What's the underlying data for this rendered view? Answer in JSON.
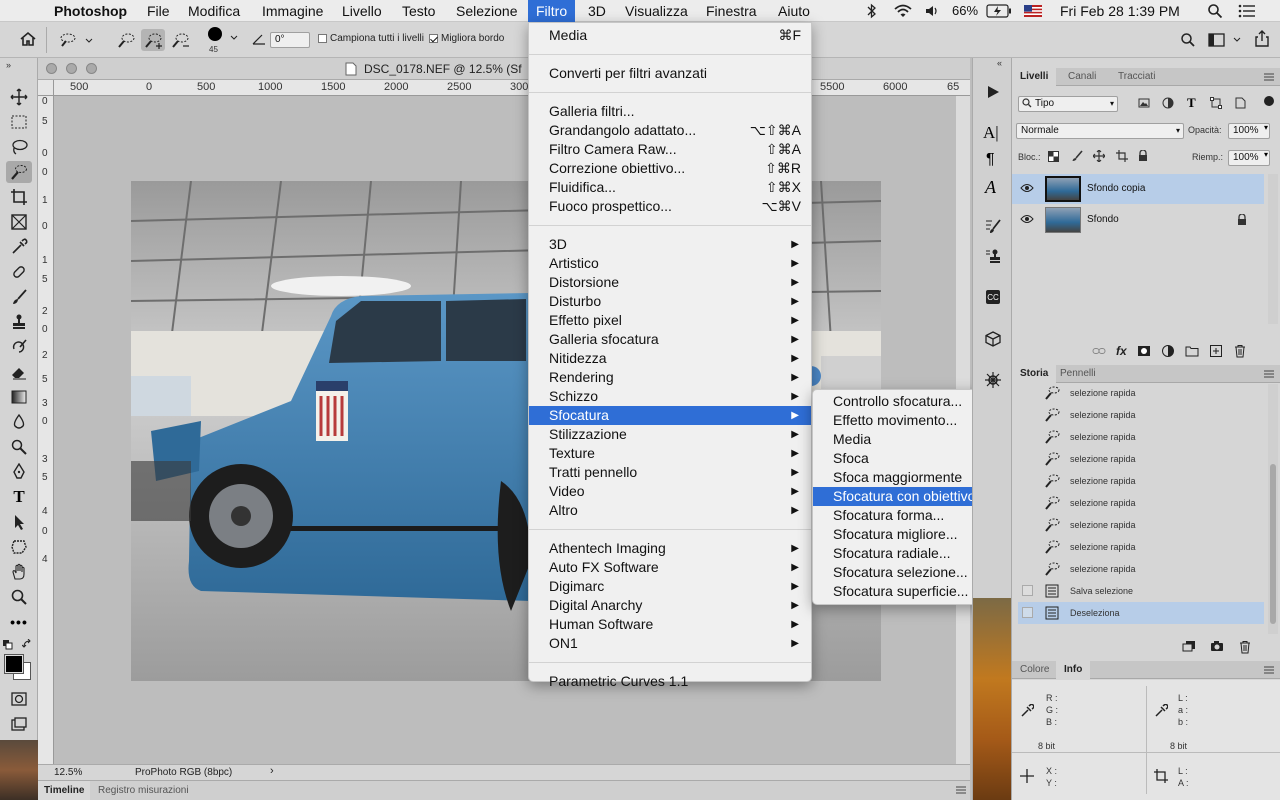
{
  "menubar": {
    "apple": "",
    "app": "Photoshop",
    "items": [
      "File",
      "Modifica",
      "Immagine",
      "Livello",
      "Testo",
      "Selezione",
      "Filtro",
      "3D",
      "Visualizza",
      "Finestra",
      "Aiuto"
    ],
    "battery": "66%",
    "datetime": "Fri Feb 28  1:39 PM"
  },
  "options": {
    "brush_size": "45",
    "angle": "0°",
    "sample_all_layers": "Campiona tutti i livelli",
    "enhance_edge": "Migliora bordo"
  },
  "document": {
    "title": "DSC_0178.NEF @ 12.5% (Sf",
    "ruler_h": [
      "500",
      "0",
      "500",
      "1000",
      "1500",
      "2000",
      "2500",
      "300"
    ],
    "ruler_h_right": [
      "5500",
      "6000",
      "65"
    ],
    "ruler_v": [
      "0",
      "5",
      "0",
      "0",
      "1",
      "0",
      "1",
      "5",
      "2",
      "0",
      "2",
      "5",
      "3",
      "0",
      "3",
      "5",
      "4",
      "0",
      "4"
    ],
    "zoom": "12.5%",
    "color_profile": "ProPhoto RGB (8bpc)"
  },
  "timeline": {
    "tabs": [
      "Timeline",
      "Registro misurazioni"
    ]
  },
  "filter_menu": {
    "groups": [
      [
        {
          "label": "Media",
          "shortcut": "⌘F"
        }
      ],
      [
        {
          "label": "Converti per filtri avanzati",
          "shortcut": ""
        }
      ],
      [
        {
          "label": "Galleria filtri...",
          "shortcut": ""
        },
        {
          "label": "Grandangolo adattato...",
          "shortcut": "⌥⇧⌘A"
        },
        {
          "label": "Filtro Camera Raw...",
          "shortcut": "⇧⌘A"
        },
        {
          "label": "Correzione obiettivo...",
          "shortcut": "⇧⌘R"
        },
        {
          "label": "Fluidifica...",
          "shortcut": "⇧⌘X"
        },
        {
          "label": "Fuoco prospettico...",
          "shortcut": "⌥⌘V"
        }
      ],
      [
        {
          "label": "3D",
          "submenu": true
        },
        {
          "label": "Artistico",
          "submenu": true
        },
        {
          "label": "Distorsione",
          "submenu": true
        },
        {
          "label": "Disturbo",
          "submenu": true
        },
        {
          "label": "Effetto pixel",
          "submenu": true
        },
        {
          "label": "Galleria sfocatura",
          "submenu": true
        },
        {
          "label": "Nitidezza",
          "submenu": true
        },
        {
          "label": "Rendering",
          "submenu": true
        },
        {
          "label": "Schizzo",
          "submenu": true
        },
        {
          "label": "Sfocatura",
          "submenu": true,
          "highlighted": true
        },
        {
          "label": "Stilizzazione",
          "submenu": true
        },
        {
          "label": "Texture",
          "submenu": true
        },
        {
          "label": "Tratti pennello",
          "submenu": true
        },
        {
          "label": "Video",
          "submenu": true
        },
        {
          "label": "Altro",
          "submenu": true
        }
      ],
      [
        {
          "label": "Athentech Imaging",
          "submenu": true
        },
        {
          "label": "Auto FX Software",
          "submenu": true
        },
        {
          "label": "Digimarc",
          "submenu": true
        },
        {
          "label": "Digital Anarchy",
          "submenu": true
        },
        {
          "label": "Human Software",
          "submenu": true
        },
        {
          "label": "ON1",
          "submenu": true
        }
      ],
      [
        {
          "label": "Parametric Curves 1.1",
          "shortcut": ""
        }
      ]
    ]
  },
  "blur_submenu": {
    "items": [
      {
        "label": "Controllo sfocatura..."
      },
      {
        "label": "Effetto movimento..."
      },
      {
        "label": "Media"
      },
      {
        "label": "Sfoca"
      },
      {
        "label": "Sfoca maggiormente"
      },
      {
        "label": "Sfocatura con obiettivo...",
        "highlighted": true
      },
      {
        "label": "Sfocatura forma..."
      },
      {
        "label": "Sfocatura migliore..."
      },
      {
        "label": "Sfocatura radiale..."
      },
      {
        "label": "Sfocatura selezione..."
      },
      {
        "label": "Sfocatura superficie..."
      }
    ]
  },
  "layers_panel": {
    "tabs": [
      "Livelli",
      "Canali",
      "Tracciati"
    ],
    "filter": "Tipo",
    "blend_mode": "Normale",
    "opacity_label": "Opacità:",
    "opacity": "100%",
    "lock_label": "Bloc.:",
    "fill_label": "Riemp.:",
    "fill": "100%",
    "layers": [
      {
        "name": "Sfondo copia",
        "selected": true
      },
      {
        "name": "Sfondo",
        "locked": true
      }
    ]
  },
  "history_panel": {
    "tabs": [
      "Storia",
      "Pennelli"
    ],
    "items": [
      "selezione rapida",
      "selezione rapida",
      "selezione rapida",
      "selezione rapida",
      "selezione rapida",
      "selezione rapida",
      "selezione rapida",
      "selezione rapida",
      "selezione rapida",
      "Salva selezione",
      "Deseleziona"
    ]
  },
  "info_panel": {
    "tabs": [
      "Colore",
      "Info"
    ],
    "rgb_labels": [
      "R :",
      "G :",
      "B :"
    ],
    "lab_labels": [
      "L :",
      "a :",
      "b :"
    ],
    "bits_left": "8 bit",
    "bits_right": "8 bit",
    "xy_labels": [
      "X :",
      "Y :"
    ],
    "la_labels": [
      "L :",
      "A :"
    ]
  },
  "colors": {
    "menu_highlight": "#2f6ed6",
    "panel_bg": "#d6d6d6",
    "selected_row": "#b7cde8",
    "truck": "#3f7fb0"
  }
}
